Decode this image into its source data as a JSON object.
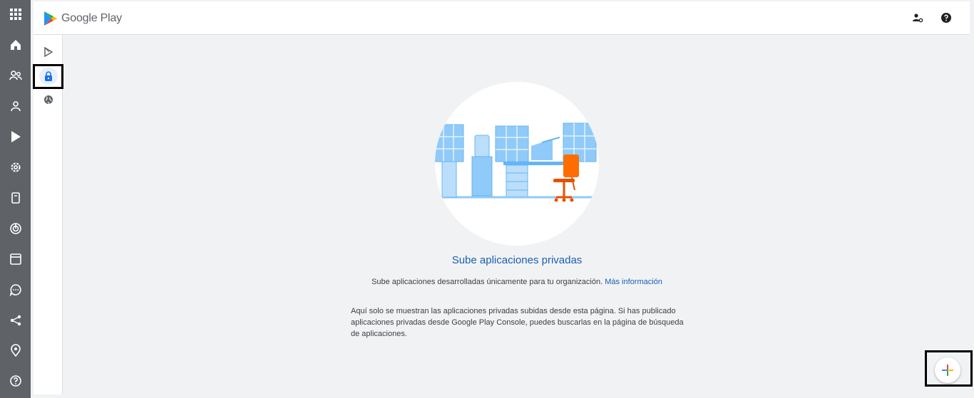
{
  "header": {
    "brand": "Google Play"
  },
  "rail": {
    "icons": [
      "apps-grid-icon",
      "home-icon",
      "users-icon",
      "user-icon",
      "play-icon",
      "gear-icon",
      "device-icon",
      "target-icon",
      "browser-icon",
      "chat-icon",
      "share-icon",
      "location-icon",
      "help-icon"
    ]
  },
  "subnav": {
    "items": [
      "play-store-icon",
      "lock-icon",
      "globe-icon"
    ],
    "active": "lock-icon"
  },
  "empty_state": {
    "title": "Sube aplicaciones privadas",
    "subtitle": "Sube aplicaciones desarrolladas únicamente para tu organización.",
    "link": "Más información",
    "note": "Aquí solo se muestran las aplicaciones privadas subidas desde esta página. Si has publicado aplicaciones privadas desde Google Play Console, puedes buscarlas en la página de búsqueda de aplicaciones."
  },
  "colors": {
    "rail": "#5f6368",
    "accent": "#1a73e8",
    "link": "#1a5fb4"
  }
}
